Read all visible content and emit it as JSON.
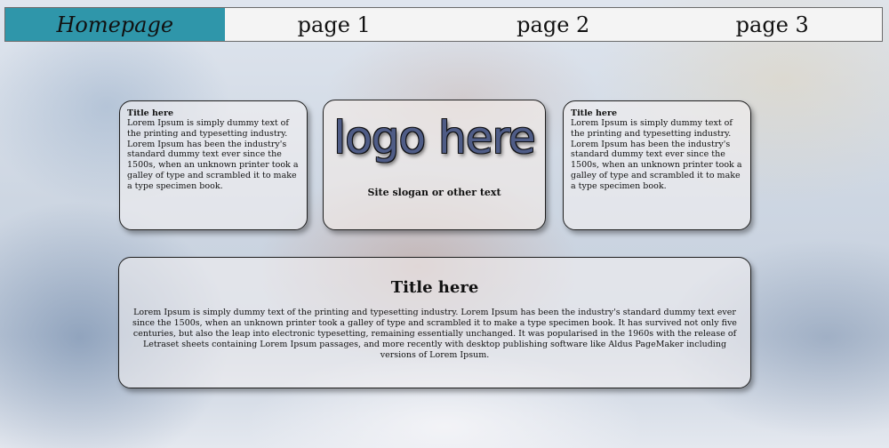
{
  "nav": {
    "items": [
      {
        "label": "Homepage",
        "active": true
      },
      {
        "label": "page 1",
        "active": false
      },
      {
        "label": "page 2",
        "active": false
      },
      {
        "label": "page 3",
        "active": false
      }
    ],
    "active_color": "#2f96aa"
  },
  "left_panel": {
    "title": "Title here",
    "text": "Lorem Ipsum is simply dummy text of the printing and typesetting industry. Lorem Ipsum has been the industry's standard dummy text ever since the 1500s, when an unknown printer took a galley of type and scrambled it to make a type specimen book."
  },
  "center_panel": {
    "logo_text": "logo here",
    "slogan": "Site slogan or other text"
  },
  "right_panel": {
    "title": "Title here",
    "text": "Lorem Ipsum is simply dummy text of the printing and typesetting industry. Lorem Ipsum has been the industry's standard dummy text ever since the 1500s, when an unknown printer took a galley of type and scrambled it to make a type specimen book."
  },
  "bottom_panel": {
    "title": "Title here",
    "text": "Lorem Ipsum is simply dummy text of the printing and typesetting industry. Lorem Ipsum has been the industry's standard dummy text ever since the 1500s, when an unknown printer took a galley of type and scrambled it to make a type specimen book. It has survived not only five centuries, but also the leap into electronic typesetting, remaining essentially unchanged. It was popularised in the 1960s with the release of Letraset sheets containing Lorem Ipsum passages, and more recently with desktop publishing software like Aldus PageMaker including versions of Lorem Ipsum."
  }
}
